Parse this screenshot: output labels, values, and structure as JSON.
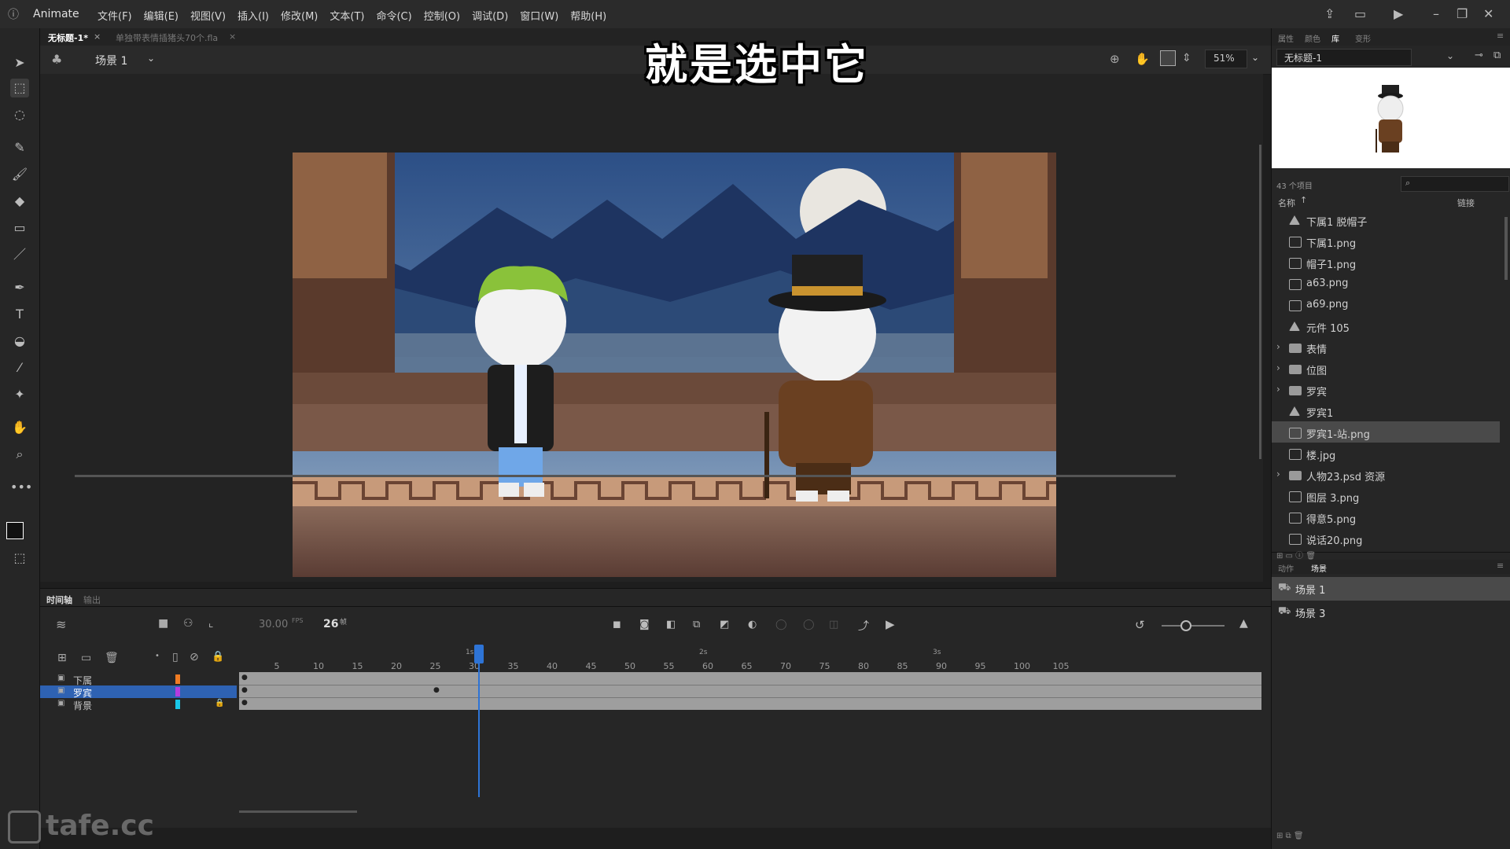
{
  "app": {
    "name": "Animate",
    "menus": [
      "文件(F)",
      "编辑(E)",
      "视图(V)",
      "插入(I)",
      "修改(M)",
      "文本(T)",
      "命令(C)",
      "控制(O)",
      "调试(D)",
      "窗口(W)",
      "帮助(H)"
    ]
  },
  "doc_tabs": [
    "无标题-1*",
    "单独带表情插猪头70个.fla"
  ],
  "editbar": {
    "scene": "场景 1",
    "zoom": "51%"
  },
  "subtitle": "就是选中它",
  "timeline": {
    "tabs": [
      "时间轴",
      "输出"
    ],
    "fps": "30.00",
    "fps_unit": "FPS",
    "frame": "26",
    "frame_unit": "帧",
    "layers": [
      {
        "name": "下属",
        "color": "#f07b22",
        "locked": false,
        "selected": false
      },
      {
        "name": "罗宾",
        "color": "#b43ce0",
        "locked": false,
        "selected": true
      },
      {
        "name": "背景",
        "color": "#19c7e8",
        "locked": true,
        "selected": false
      }
    ],
    "ruler_numbers": [
      "5",
      "10",
      "15",
      "20",
      "25",
      "30",
      "35",
      "40",
      "45",
      "50",
      "55",
      "60",
      "65",
      "70",
      "75",
      "80",
      "85",
      "90",
      "95",
      "100",
      "105"
    ],
    "ruler_seconds": [
      "1s",
      "2s",
      "3s"
    ]
  },
  "right_panel": {
    "tabs": [
      "属性",
      "颜色",
      "库",
      "变形"
    ],
    "doc_select": "无标题-1",
    "item_count": "43 个项目",
    "col_name": "名称",
    "col_link": "链接",
    "library": [
      {
        "name": "下属1 脱帽子",
        "type": "symbol"
      },
      {
        "name": "下属1.png",
        "type": "bitmap"
      },
      {
        "name": "帽子1.png",
        "type": "bitmap"
      },
      {
        "name": "a63.png",
        "type": "bitmap"
      },
      {
        "name": "a69.png",
        "type": "bitmap"
      },
      {
        "name": "元件 105",
        "type": "symbol"
      },
      {
        "name": "表情",
        "type": "folder"
      },
      {
        "name": "位图",
        "type": "folder"
      },
      {
        "name": "罗宾",
        "type": "folder"
      },
      {
        "name": "罗宾1",
        "type": "symbol"
      },
      {
        "name": "罗宾1-站.png",
        "type": "bitmap",
        "selected": true
      },
      {
        "name": "楼.jpg",
        "type": "bitmap"
      },
      {
        "name": "人物23.psd 资源",
        "type": "folder"
      },
      {
        "name": "图层 3.png",
        "type": "bitmap"
      },
      {
        "name": "得意5.png",
        "type": "bitmap"
      },
      {
        "name": "说话20.png",
        "type": "bitmap"
      }
    ],
    "scene_tabs": [
      "动作",
      "场景"
    ],
    "scenes": [
      "场景 1",
      "场景 3"
    ]
  },
  "watermark": "tafe.cc"
}
